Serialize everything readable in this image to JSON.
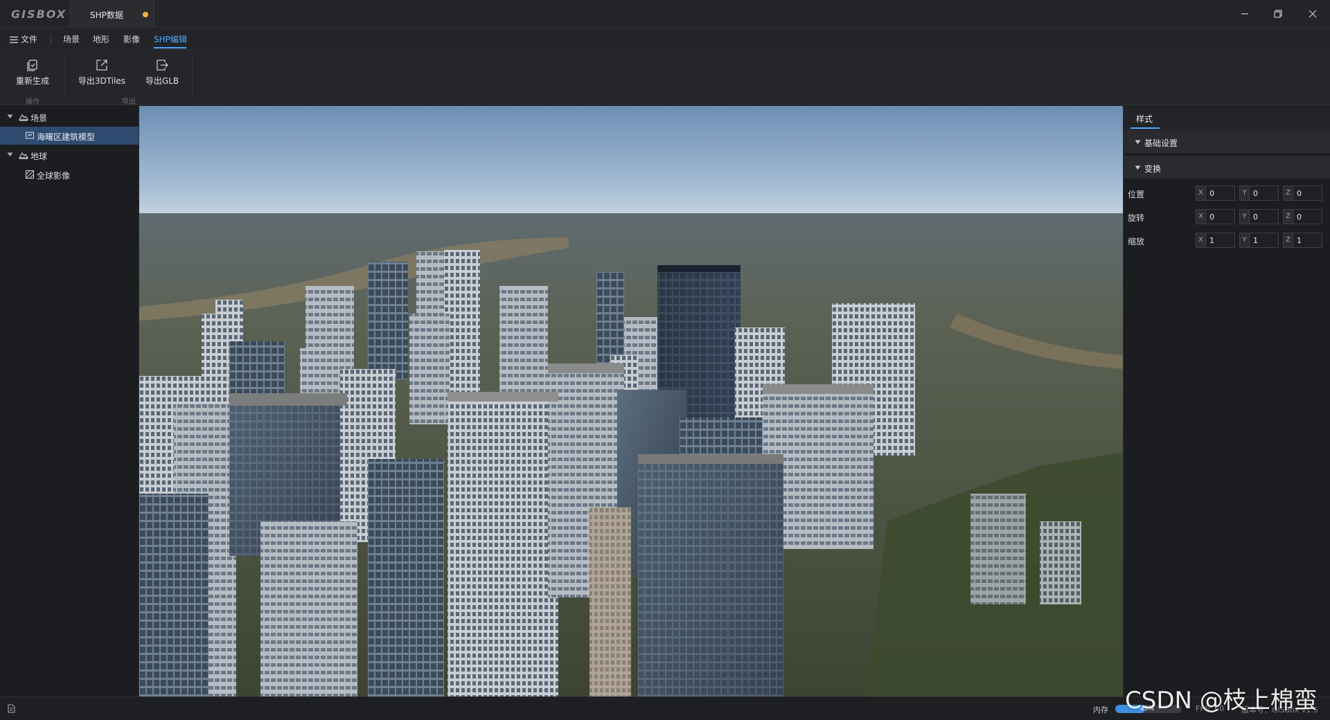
{
  "app": {
    "logo_text": "GISBOX",
    "document_tab": "SHP数据"
  },
  "menu": {
    "file": "文件",
    "scene": "场景",
    "terrain": "地形",
    "imagery": "影像",
    "shp_edit": "SHP编辑"
  },
  "ribbon": {
    "regenerate": "重新生成",
    "export_3dtiles": "导出3DTiles",
    "export_glb": "导出GLB",
    "group_ops": "操作",
    "group_export": "导出"
  },
  "tree": {
    "scene": "场景",
    "building_model": "海曙区建筑模型",
    "earth": "地球",
    "global_imagery": "全球影像"
  },
  "props": {
    "tab_style": "样式",
    "section_basic": "基础设置",
    "section_transform": "变换",
    "position_label": "位置",
    "rotation_label": "旋转",
    "scale_label": "缩放",
    "axis_x": "X",
    "axis_y": "Y",
    "axis_z": "Z",
    "position": {
      "x": "0",
      "y": "0",
      "z": "0"
    },
    "rotation": {
      "x": "0",
      "y": "0",
      "z": "0"
    },
    "scale": {
      "x": "1",
      "y": "1",
      "z": "1"
    }
  },
  "status": {
    "memory_label": "内存",
    "memory_percent": "45%",
    "memory_fraction": 0.45,
    "fps": "FPS: 60",
    "version": "版本号：GISBox v1.5"
  },
  "watermark": "CSDN @枝上棉蛮",
  "colors": {
    "accent": "#4fa9ff",
    "unsaved_dot": "#f0b53a",
    "selected_row": "#2e4a6e"
  }
}
